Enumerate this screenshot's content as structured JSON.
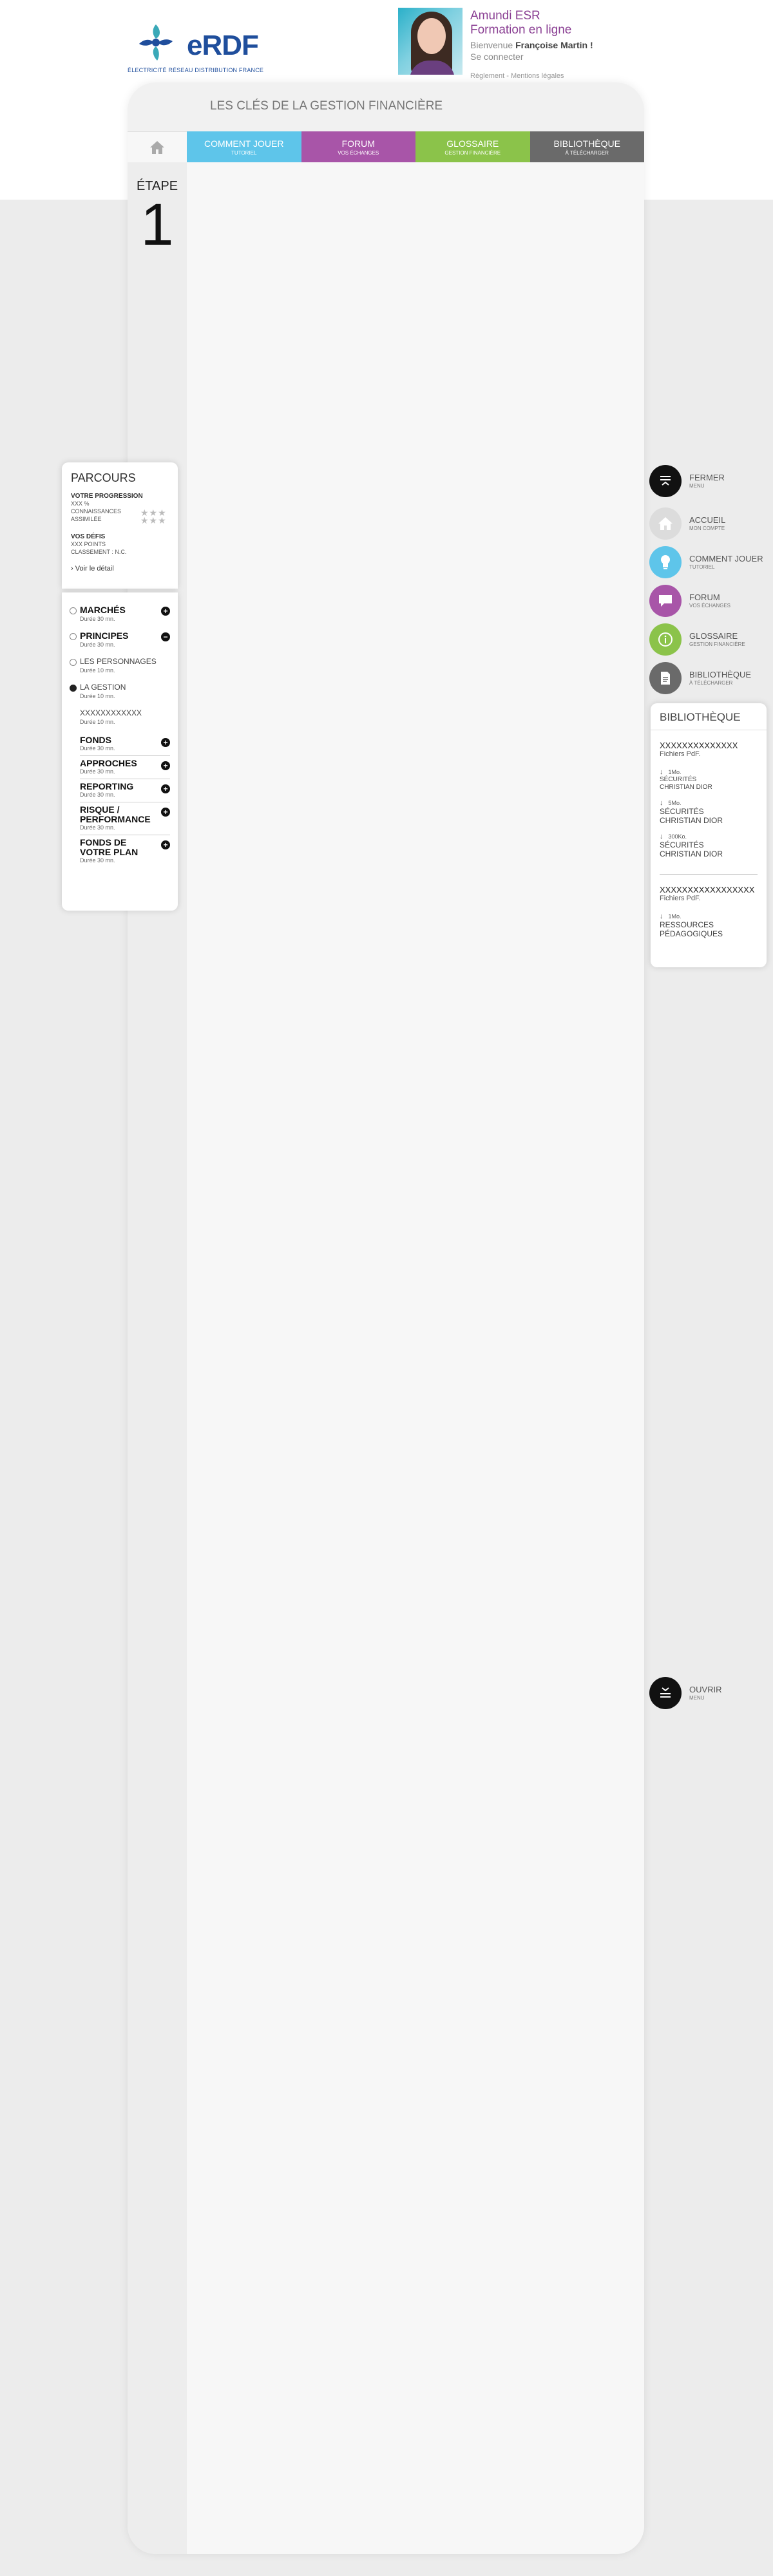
{
  "header": {
    "logo_text": "eRDF",
    "logo_tagline": "ÉLECTRICITÉ RÉSEAU DISTRIBUTION FRANCE",
    "title_line1": "Amundi ESR",
    "title_line2": "Formation en ligne",
    "welcome_prefix": "Bienvenue",
    "user_name": "Françoise Martin !",
    "login_link": "Se connecter",
    "legal_links": "Règlement - Mentions légales"
  },
  "frame": {
    "title": "LES CLÉS DE LA GESTION FINANCIÈRE"
  },
  "tabs": [
    {
      "label": "COMMENT JOUER",
      "sub": "TUTORIEL",
      "color": "#5ec5ea"
    },
    {
      "label": "FORUM",
      "sub": "VOS ÉCHANGES",
      "color": "#a855a8"
    },
    {
      "label": "GLOSSAIRE",
      "sub": "GESTION FINANCIÈRE",
      "color": "#8bc34a"
    },
    {
      "label": "BIBLIOTHÈQUE",
      "sub": "À TÉLÉCHARGER",
      "color": "#6a6a6a"
    }
  ],
  "etape": {
    "label": "ÉTAPE",
    "number": "1"
  },
  "parcours": {
    "title": "PARCOURS",
    "progress_title": "VOTRE PROGRESSION",
    "progress_line1": "XXX %",
    "progress_line2": "CONNAISSANCES",
    "progress_line3": "ASSIMILÉE",
    "defis_title": "VOS DÉFIS",
    "defis_line1": "XXX POINTS",
    "defis_line2": "CLASSEMENT : N.C.",
    "detail_link": "Voir le détail",
    "stars": "★★★"
  },
  "modules": [
    {
      "name": "MARCHÉS",
      "duration": "Durée 30 mn.",
      "toggle": "+"
    },
    {
      "name": "PRINCIPES",
      "duration": "Durée 30 mn.",
      "toggle": "−"
    },
    {
      "name": "LES PERSONNAGES",
      "duration": "Durée 10 mn."
    },
    {
      "name": "LA GESTION",
      "duration": "Durée 10 mn."
    },
    {
      "name": "XXXXXXXXXXXX",
      "duration": "Durée 10 mn."
    }
  ],
  "sub_modules": [
    {
      "name": "FONDS",
      "duration": "Durée 30 mn.",
      "toggle": "+"
    },
    {
      "name": "APPROCHES",
      "duration": "Durée 30 mn.",
      "toggle": "+"
    },
    {
      "name": "REPORTING",
      "duration": "Durée 30 mn.",
      "toggle": "+"
    },
    {
      "name": "RISQUE / PERFORMANCE",
      "duration": "Durée 30 mn.",
      "toggle": "+"
    },
    {
      "name": "FONDS DE VOTRE PLAN",
      "duration": "Durée 30 mn.",
      "toggle": "+"
    }
  ],
  "right_menu": {
    "fermer": {
      "label": "FERMER",
      "sub": "MENU",
      "color": "#111111"
    },
    "accueil": {
      "label": "ACCUEIL",
      "sub": "MON COMPTE",
      "color": "#dcdcdc"
    },
    "comment": {
      "label": "COMMENT JOUER",
      "sub": "TUTORIEL",
      "color": "#5ec5ea"
    },
    "forum": {
      "label": "FORUM",
      "sub": "VOS ÉCHANGES",
      "color": "#a855a8"
    },
    "glossaire": {
      "label": "GLOSSAIRE",
      "sub": "GESTION FINANCIÈRE",
      "color": "#8bc34a"
    },
    "bibliotheque": {
      "label": "BIBLIOTHÈQUE",
      "sub": "À TÉLÉCHARGER",
      "color": "#6a6a6a"
    },
    "ouvrir": {
      "label": "OUVRIR",
      "sub": "MENU",
      "color": "#111111"
    }
  },
  "library": {
    "title": "BIBLIOTHÈQUE",
    "group1": {
      "title": "XXXXXXXXXXXXXX",
      "subtitle": "Fichiers PdF.",
      "files": [
        {
          "size": "1Mo.",
          "line1": "SÉCURITÉS",
          "line2": "CHRISTIAN DIOR"
        },
        {
          "size": "5Mo.",
          "line1": "SÉCURITÉS",
          "line2": "CHRISTIAN DIOR"
        },
        {
          "size": "300Ko.",
          "line1": "SÉCURITÉS",
          "line2": "CHRISTIAN DIOR"
        }
      ]
    },
    "group2": {
      "title": "XXXXXXXXXXXXXXXXX",
      "subtitle": "Fichiers PdF.",
      "files": [
        {
          "size": "1Mo.",
          "line1": "RESSOURCES",
          "line2": "PÉDAGOGIQUES"
        }
      ]
    }
  }
}
